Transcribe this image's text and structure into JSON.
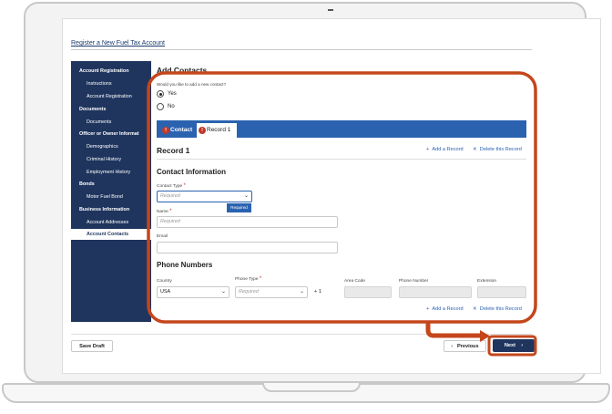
{
  "page": {
    "title": "Register a New Fuel Tax Account"
  },
  "sidebar": {
    "items": [
      {
        "label": "Account Registration",
        "kind": "head"
      },
      {
        "label": "Instructions",
        "kind": "sub"
      },
      {
        "label": "Account Registration",
        "kind": "sub"
      },
      {
        "label": "Documents",
        "kind": "head"
      },
      {
        "label": "Documents",
        "kind": "sub"
      },
      {
        "label": "Officer or Owner Informat",
        "kind": "head"
      },
      {
        "label": "Demographics",
        "kind": "sub"
      },
      {
        "label": "Criminal History",
        "kind": "sub"
      },
      {
        "label": "Employment History",
        "kind": "sub"
      },
      {
        "label": "Bonds",
        "kind": "head"
      },
      {
        "label": "Motor Fuel Bond",
        "kind": "sub"
      },
      {
        "label": "Business Information",
        "kind": "head"
      },
      {
        "label": "Account Addresses",
        "kind": "sub"
      },
      {
        "label": "Account Contacts",
        "kind": "active"
      }
    ]
  },
  "main": {
    "title": "Add Contacts",
    "question": "Would you like to add a new contact?",
    "radio_yes": "Yes",
    "radio_no": "No",
    "radio_selected": "Yes",
    "tabs": [
      "Contact",
      "Record 1"
    ],
    "tab_error_icon": "!",
    "record_title": "Record 1",
    "add_record": "Add a Record",
    "delete_record": "Delete this Record",
    "contact_section": "Contact Information",
    "contact_type_label": "Contact Type",
    "contact_type_placeholder": "Required",
    "tooltip": "Required",
    "name_label": "Name",
    "name_placeholder": "Required",
    "email_label": "Email",
    "phone_section": "Phone Numbers",
    "country_label": "Country",
    "country_value": "USA",
    "phone_type_label": "Phone Type",
    "phone_type_placeholder": "Required",
    "dial_code": "+ 1",
    "area_code_label": "Area Code",
    "phone_number_label": "Phone Number",
    "extension_label": "Extension",
    "required_marker": "*"
  },
  "footer": {
    "save_draft": "Save Draft",
    "previous": "Previous",
    "next": "Next"
  },
  "colors": {
    "navy": "#1f355e",
    "tab_blue": "#2a62b0",
    "highlight": "#c4461b",
    "error": "#c0392b"
  }
}
